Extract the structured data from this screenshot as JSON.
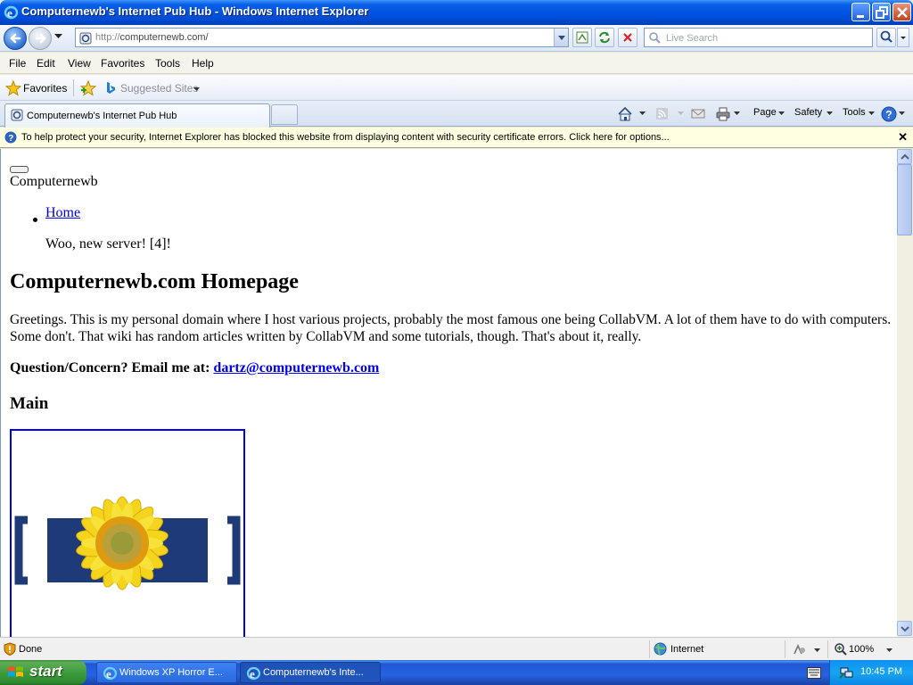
{
  "window": {
    "title": "Computernewb's Internet Pub Hub - Windows Internet Explorer"
  },
  "address_bar": {
    "url_protocol": "http://",
    "url_rest": "computernewb.com/",
    "search_placeholder": "Live Search"
  },
  "menu": [
    "File",
    "Edit",
    "View",
    "Favorites",
    "Tools",
    "Help"
  ],
  "favorites_bar": {
    "favorites_label": "Favorites",
    "suggested_label": "Suggested Sites"
  },
  "tab": {
    "title": "Computernewb's Internet Pub Hub"
  },
  "command_bar": {
    "page": "Page",
    "safety": "Safety",
    "tools": "Tools"
  },
  "info_bar": {
    "message": "To help protect your security, Internet Explorer has blocked this website from displaying content with security certificate errors. Click here for options..."
  },
  "page": {
    "site_name": "Computernewb",
    "nav_home": "Home",
    "announcement": "Woo, new server! [4]!",
    "heading": "Computernewb.com Homepage",
    "intro_line1": "Greetings. This is my personal domain where I host various projects, probably the most famous one being CollabVM. A lot of them have to do with computers.",
    "intro_line2": "Some don't. That wiki has random articles written by CollabVM and some tutorials, though. That's about it, really.",
    "contact_prefix": "Question/Concern? Email me at:",
    "contact_email": "dartz@computernewb.com",
    "section_main": "Main"
  },
  "status_bar": {
    "status": "Done",
    "zone": "Internet",
    "zoom": "100%"
  },
  "taskbar": {
    "start": "start",
    "tasks": [
      "Windows XP Horror E...",
      "Computernewb's Inte..."
    ],
    "clock": "10:45 PM"
  },
  "colors": {
    "title_bar": "#0054e3",
    "link": "#0000ee",
    "info_bar": "#ffffe1",
    "start_button": "#3c9c3c"
  }
}
